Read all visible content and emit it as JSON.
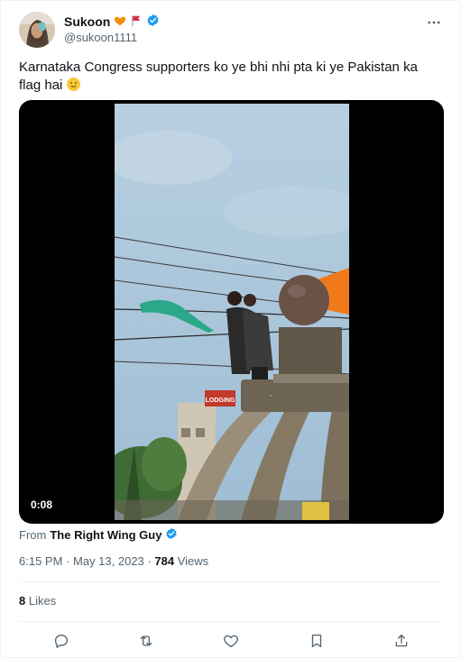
{
  "tweet": {
    "author": {
      "name": "Sukoon",
      "handle": "@sukoon1111",
      "badges": [
        "orange-heart-icon",
        "red-flag-icon",
        "verified-badge-icon"
      ]
    },
    "text": "Karnataka Congress supporters ko ye bhi nhi pta ki ye Pakistan ka flag hai",
    "text_emoji": "slightly-smiling-face-icon",
    "media": {
      "duration": "0:08",
      "sign_text": "LODGING",
      "colors": {
        "flag_green": "#2aa889",
        "sky": "#aac6dc",
        "saffron": "#f07a1a"
      }
    },
    "attribution": {
      "prefix": "From",
      "source": "The Right Wing Guy"
    },
    "timestamp": {
      "time": "6:15 PM",
      "separator": "·",
      "date": "May 13, 2023",
      "views_count": "784",
      "views_label": "Views"
    },
    "engagement": {
      "likes_count": "8",
      "likes_label": "Likes"
    },
    "actions": [
      "reply-icon",
      "retweet-icon",
      "like-icon",
      "bookmark-icon",
      "share-icon"
    ],
    "colors": {
      "verified": "#1d9bf0",
      "secondary_text": "#536471",
      "primary_text": "#0f1419"
    }
  }
}
